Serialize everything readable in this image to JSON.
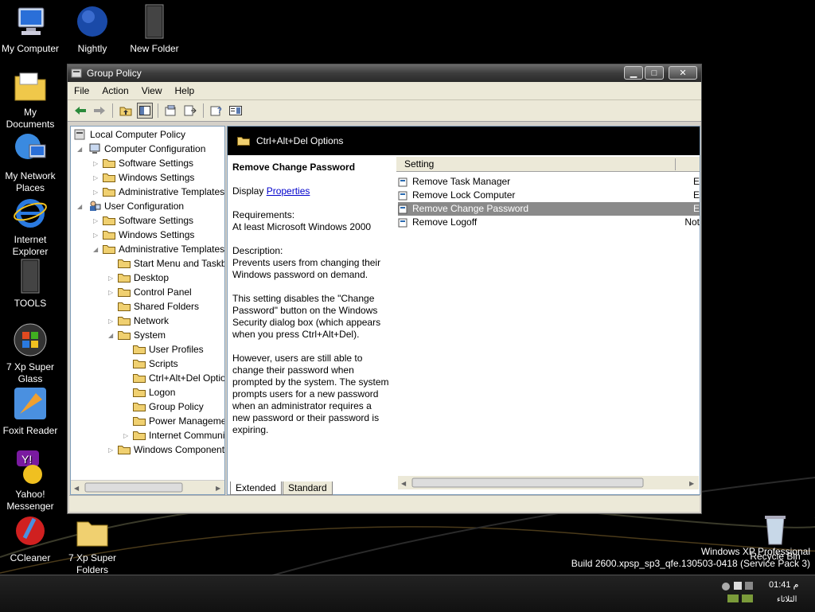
{
  "desktop": {
    "icons": [
      {
        "label": "My Computer",
        "icon": "my-computer-icon"
      },
      {
        "label": "Nightly",
        "icon": "globe-icon"
      },
      {
        "label": "New Folder",
        "icon": "folder-icon"
      },
      {
        "label": "My Documents",
        "icon": "documents-folder-icon"
      },
      {
        "label": "My Network Places",
        "icon": "network-places-icon"
      },
      {
        "label": "Internet Explorer",
        "icon": "ie-icon"
      },
      {
        "label": "TOOLS",
        "icon": "folder-icon"
      },
      {
        "label": "7 Xp Super Glass",
        "icon": "windows-logo-icon"
      },
      {
        "label": "Foxit Reader",
        "icon": "foxit-icon"
      },
      {
        "label": "Yahoo! Messenger",
        "icon": "yahoo-icon"
      },
      {
        "label": "CCleaner",
        "icon": "ccleaner-icon"
      },
      {
        "label": "7 Xp Super Folders",
        "icon": "folder-icon"
      },
      {
        "label": "Recycle Bin",
        "icon": "recycle-bin-icon"
      }
    ],
    "watermark_line1": "Windows XP Professional",
    "watermark_line2": "Build 2600.xpsp_sp3_qfe.130503-0418 (Service Pack 3)"
  },
  "window": {
    "title": "Group Policy",
    "controls": {
      "minimize": "▁",
      "maximize": "□",
      "close": "✕"
    },
    "menu": [
      "File",
      "Action",
      "View",
      "Help"
    ],
    "tree": {
      "root": "Local Computer Policy",
      "computer_config": "Computer Configuration",
      "cc_software": "Software Settings",
      "cc_windows": "Windows Settings",
      "cc_admin": "Administrative Templates",
      "user_config": "User Configuration",
      "uc_software": "Software Settings",
      "uc_windows": "Windows Settings",
      "uc_admin": "Administrative Templates",
      "start_menu": "Start Menu and Taskbar",
      "desktop": "Desktop",
      "control_panel": "Control Panel",
      "shared_folders": "Shared Folders",
      "network": "Network",
      "system": "System",
      "user_profiles": "User Profiles",
      "scripts": "Scripts",
      "ctrl_alt_del": "Ctrl+Alt+Del Options",
      "logon": "Logon",
      "group_policy": "Group Policy",
      "power_mgmt": "Power Management",
      "internet_comm": "Internet Communication",
      "windows_components": "Windows Components"
    },
    "header_title": "Ctrl+Alt+Del Options",
    "description": {
      "title": "Remove Change Password",
      "display_prefix": "Display",
      "properties_link": "Properties",
      "requirements_label": "Requirements:",
      "requirements_text": "At least Microsoft Windows 2000",
      "description_label": "Description:",
      "para1": "Prevents users from changing their Windows password on demand.",
      "para2": "This setting disables the \"Change Password\" button on the Windows Security dialog box (which appears when you press Ctrl+Alt+Del).",
      "para3": "However, users are still able to change their password when prompted by the system. The system prompts users for a new password when an administrator requires a new password or their password is expiring."
    },
    "list": {
      "column_setting": "Setting",
      "rows": [
        {
          "name": "Remove Task Manager",
          "state": "E"
        },
        {
          "name": "Remove Lock Computer",
          "state": "E"
        },
        {
          "name": "Remove Change Password",
          "state": "E"
        },
        {
          "name": "Remove Logoff",
          "state": "Not"
        }
      ]
    },
    "tabs": {
      "extended": "Extended",
      "standard": "Standard"
    }
  },
  "taskbar": {
    "clock": "01:41 م",
    "date": "الثلاثاء"
  }
}
